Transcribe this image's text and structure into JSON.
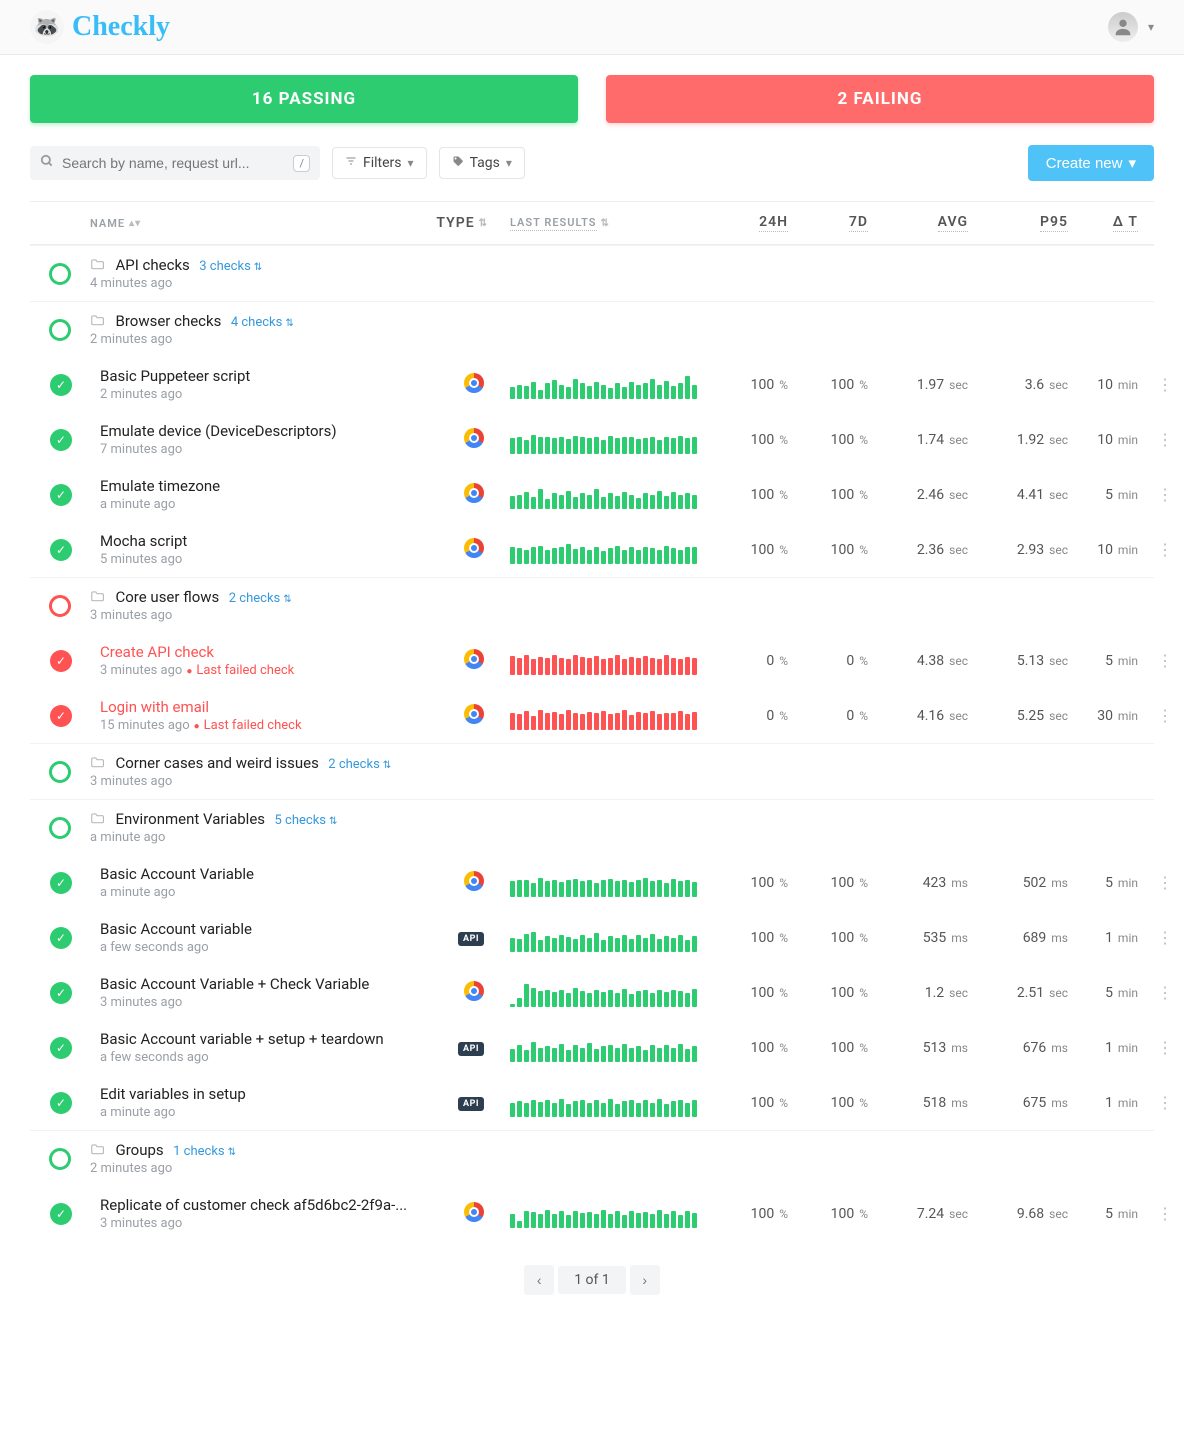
{
  "brand": "Checkly",
  "status": {
    "pass_label": "16 PASSING",
    "fail_label": "2 FAILING"
  },
  "toolbar": {
    "search_placeholder": "Search by name, request url...",
    "kbd": "/",
    "filters_label": "Filters",
    "tags_label": "Tags",
    "create_label": "Create new"
  },
  "columns": {
    "name": "NAME",
    "type": "TYPE",
    "last_results": "LAST RESULTS",
    "h24": "24H",
    "d7": "7D",
    "avg": "AVG",
    "p95": "P95",
    "dt": "Δ T"
  },
  "groups": [
    {
      "id": "api-checks",
      "status": "pass",
      "title": "API checks",
      "link": "3 checks",
      "timestamp": "4 minutes ago",
      "checks": []
    },
    {
      "id": "browser-checks",
      "status": "pass",
      "title": "Browser checks",
      "link": "4 checks",
      "timestamp": "2 minutes ago",
      "checks": [
        {
          "name": "Basic Puppeteer script",
          "ts": "2 minutes ago",
          "fail": false,
          "type": "chrome",
          "h24": "100",
          "d7": "100",
          "avg_v": "1.97",
          "avg_u": "sec",
          "p95_v": "3.6",
          "p95_u": "sec",
          "dt_v": "10",
          "dt_u": "min",
          "spark": [
            40,
            50,
            45,
            60,
            30,
            55,
            65,
            48,
            40,
            70,
            55,
            45,
            60,
            50,
            38,
            55,
            42,
            60,
            48,
            55,
            70,
            50,
            62,
            45,
            55,
            80,
            50
          ]
        },
        {
          "name": "Emulate device (DeviceDescriptors)",
          "ts": "7 minutes ago",
          "fail": false,
          "type": "chrome",
          "h24": "100",
          "d7": "100",
          "avg_v": "1.74",
          "avg_u": "sec",
          "p95_v": "1.92",
          "p95_u": "sec",
          "dt_v": "10",
          "dt_u": "min",
          "spark": [
            55,
            60,
            50,
            65,
            60,
            58,
            55,
            60,
            52,
            63,
            58,
            55,
            60,
            50,
            62,
            55,
            58,
            60,
            52,
            55,
            60,
            50,
            58,
            55,
            62,
            56,
            60
          ]
        },
        {
          "name": "Emulate timezone",
          "ts": "a minute ago",
          "fail": false,
          "type": "chrome",
          "h24": "100",
          "d7": "100",
          "avg_v": "2.46",
          "avg_u": "sec",
          "p95_v": "4.41",
          "p95_u": "sec",
          "dt_v": "5",
          "dt_u": "min",
          "spark": [
            45,
            50,
            60,
            40,
            70,
            35,
            55,
            48,
            62,
            42,
            55,
            50,
            68,
            40,
            55,
            45,
            60,
            50,
            38,
            55,
            48,
            62,
            44,
            58,
            50,
            55,
            48
          ]
        },
        {
          "name": "Mocha script",
          "ts": "5 minutes ago",
          "fail": false,
          "type": "chrome",
          "h24": "100",
          "d7": "100",
          "avg_v": "2.36",
          "avg_u": "sec",
          "p95_v": "2.93",
          "p95_u": "sec",
          "dt_v": "10",
          "dt_u": "min",
          "spark": [
            60,
            55,
            50,
            58,
            62,
            48,
            55,
            60,
            70,
            52,
            58,
            50,
            60,
            45,
            55,
            62,
            50,
            58,
            48,
            60,
            55,
            50,
            62,
            55,
            48,
            58,
            60
          ]
        }
      ]
    },
    {
      "id": "core-user-flows",
      "status": "fail",
      "title": "Core user flows",
      "link": "2 checks",
      "timestamp": "3 minutes ago",
      "checks": [
        {
          "name": "Create API check",
          "ts": "3 minutes ago",
          "fail": true,
          "fail_label": "Last failed check",
          "type": "chrome",
          "h24": "0",
          "d7": "0",
          "avg_v": "4.38",
          "avg_u": "sec",
          "p95_v": "5.13",
          "p95_u": "sec",
          "dt_v": "5",
          "dt_u": "min",
          "spark": [
            65,
            60,
            70,
            55,
            62,
            58,
            68,
            60,
            55,
            70,
            62,
            58,
            65,
            55,
            60,
            68,
            55,
            62,
            58,
            65,
            60,
            55,
            68,
            60,
            55,
            62,
            58
          ]
        },
        {
          "name": "Login with email",
          "ts": "15 minutes ago",
          "fail": true,
          "fail_label": "Last failed check",
          "type": "chrome",
          "h24": "0",
          "d7": "0",
          "avg_v": "4.16",
          "avg_u": "sec",
          "p95_v": "5.25",
          "p95_u": "sec",
          "dt_v": "30",
          "dt_u": "min",
          "spark": [
            60,
            55,
            65,
            50,
            70,
            58,
            62,
            55,
            68,
            60,
            55,
            63,
            58,
            65,
            55,
            60,
            68,
            52,
            62,
            58,
            65,
            55,
            60,
            58,
            65,
            55,
            62
          ]
        }
      ]
    },
    {
      "id": "corner-cases",
      "status": "pass",
      "title": "Corner cases and weird issues",
      "link": "2 checks",
      "timestamp": "3 minutes ago",
      "checks": []
    },
    {
      "id": "env-vars",
      "status": "pass",
      "title": "Environment Variables",
      "link": "5 checks",
      "timestamp": "a minute ago",
      "checks": [
        {
          "name": "Basic Account Variable",
          "ts": "a minute ago",
          "fail": false,
          "type": "chrome",
          "h24": "100",
          "d7": "100",
          "avg_v": "423",
          "avg_u": "ms",
          "p95_v": "502",
          "p95_u": "ms",
          "dt_v": "5",
          "dt_u": "min",
          "spark": [
            55,
            60,
            58,
            50,
            65,
            55,
            60,
            52,
            58,
            62,
            55,
            60,
            50,
            58,
            62,
            55,
            60,
            52,
            58,
            65,
            55,
            60,
            50,
            62,
            55,
            60,
            52
          ]
        },
        {
          "name": "Basic Account variable",
          "ts": "a few seconds ago",
          "fail": false,
          "type": "api",
          "h24": "100",
          "d7": "100",
          "avg_v": "535",
          "avg_u": "ms",
          "p95_v": "689",
          "p95_u": "ms",
          "dt_v": "1",
          "dt_u": "min",
          "spark": [
            50,
            45,
            62,
            70,
            40,
            55,
            48,
            60,
            52,
            45,
            58,
            50,
            65,
            42,
            55,
            48,
            60,
            45,
            58,
            50,
            62,
            44,
            55,
            48,
            60,
            42,
            55
          ]
        },
        {
          "name": "Basic Account Variable + Check Variable",
          "ts": "3 minutes ago",
          "fail": false,
          "type": "chrome",
          "h24": "100",
          "d7": "100",
          "avg_v": "1.2",
          "avg_u": "sec",
          "p95_v": "2.51",
          "p95_u": "sec",
          "dt_v": "5",
          "dt_u": "min",
          "spark": [
            10,
            30,
            80,
            65,
            55,
            60,
            52,
            58,
            50,
            65,
            55,
            48,
            60,
            52,
            58,
            50,
            62,
            45,
            55,
            60,
            50,
            58,
            52,
            60,
            55,
            48,
            62
          ]
        },
        {
          "name": "Basic Account variable + setup + teardown",
          "ts": "a few seconds ago",
          "fail": false,
          "type": "api",
          "h24": "100",
          "d7": "100",
          "avg_v": "513",
          "avg_u": "ms",
          "p95_v": "676",
          "p95_u": "ms",
          "dt_v": "1",
          "dt_u": "min",
          "spark": [
            45,
            60,
            40,
            70,
            50,
            55,
            48,
            62,
            42,
            58,
            50,
            65,
            45,
            55,
            60,
            48,
            62,
            50,
            55,
            42,
            60,
            48,
            58,
            50,
            62,
            45,
            55
          ]
        },
        {
          "name": "Edit variables in setup",
          "ts": "a minute ago",
          "fail": false,
          "type": "api",
          "h24": "100",
          "d7": "100",
          "avg_v": "518",
          "avg_u": "ms",
          "p95_v": "675",
          "p95_u": "ms",
          "dt_v": "1",
          "dt_u": "min",
          "spark": [
            50,
            55,
            48,
            60,
            52,
            58,
            50,
            62,
            45,
            55,
            60,
            48,
            58,
            50,
            62,
            45,
            55,
            60,
            48,
            58,
            50,
            62,
            45,
            55,
            60,
            48,
            58
          ]
        }
      ]
    },
    {
      "id": "groups",
      "status": "pass",
      "title": "Groups",
      "link": "1 checks",
      "timestamp": "2 minutes ago",
      "checks": [
        {
          "name": "Replicate of customer check af5d6bc2-2f9a-...",
          "ts": "3 minutes ago",
          "fail": false,
          "type": "chrome",
          "h24": "100",
          "d7": "100",
          "avg_v": "7.24",
          "avg_u": "sec",
          "p95_v": "9.68",
          "p95_u": "sec",
          "dt_v": "5",
          "dt_u": "min",
          "spark": [
            50,
            25,
            60,
            55,
            48,
            62,
            50,
            58,
            45,
            60,
            52,
            55,
            48,
            62,
            50,
            58,
            45,
            60,
            52,
            55,
            48,
            62,
            50,
            58,
            45,
            60,
            52
          ]
        }
      ]
    }
  ],
  "pager": {
    "label": "1 of 1"
  }
}
